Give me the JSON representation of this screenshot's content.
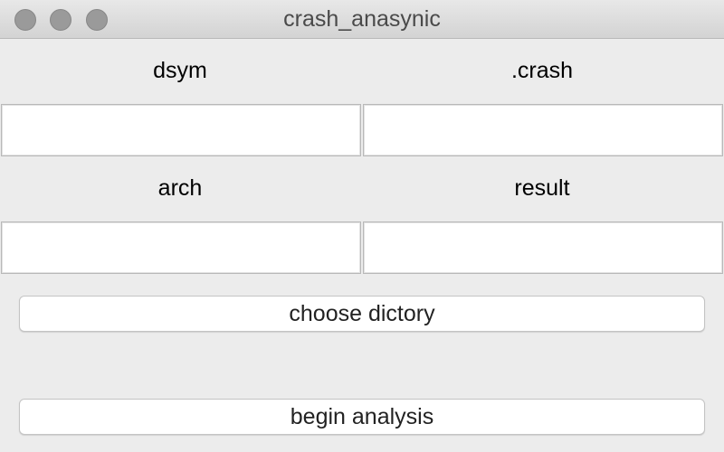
{
  "window": {
    "title": "crash_anasynic"
  },
  "fields": {
    "dsym": {
      "label": "dsym",
      "value": ""
    },
    "crash": {
      "label": ".crash",
      "value": ""
    },
    "arch": {
      "label": "arch",
      "value": ""
    },
    "result": {
      "label": "result",
      "value": ""
    }
  },
  "buttons": {
    "choose_label": "choose dictory",
    "analyze_label": "begin analysis"
  }
}
